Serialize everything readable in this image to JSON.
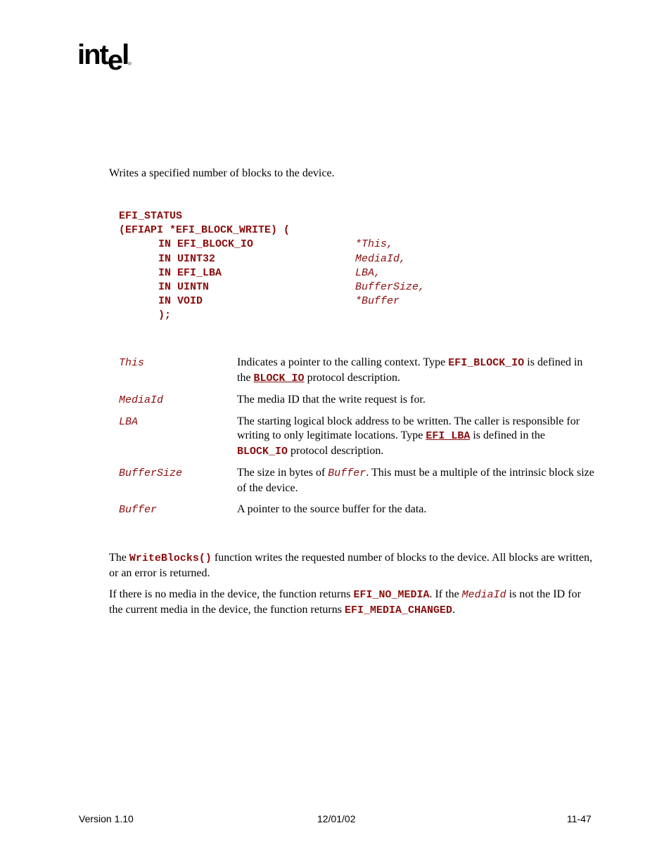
{
  "header": {
    "logo_text": "intel",
    "logo_main": "int",
    "logo_e": "e",
    "logo_l": "l",
    "logo_reg": "®"
  },
  "summary": "Writes a specified number of blocks to the device.",
  "prototype": {
    "return_type": "EFI_STATUS",
    "signature": "(EFIAPI *EFI_BLOCK_WRITE) (",
    "params": [
      {
        "type": "IN EFI_BLOCK_IO",
        "name": "*This,"
      },
      {
        "type": "IN UINT32",
        "name": "MediaId,"
      },
      {
        "type": "IN EFI_LBA",
        "name": "LBA,"
      },
      {
        "type": "IN UINTN",
        "name": "BufferSize,"
      },
      {
        "type": "IN VOID",
        "name": "*Buffer"
      }
    ],
    "close": ");"
  },
  "parameters": [
    {
      "name": "This",
      "desc_parts": [
        "Indicates a pointer to the calling context.  Type ",
        "EFI_BLOCK_IO",
        " is defined in the ",
        "BLOCK_IO",
        " protocol description."
      ]
    },
    {
      "name": "MediaId",
      "desc": "The media ID that the write request is for."
    },
    {
      "name": "LBA",
      "desc_parts": [
        "The starting logical block address to be written.  The caller is responsible for writing to only legitimate locations.  Type ",
        "EFI_LBA",
        " is defined in the ",
        "BLOCK_IO",
        " protocol description."
      ]
    },
    {
      "name": "BufferSize",
      "desc_parts": [
        "The size in bytes of ",
        "Buffer",
        ".  This must be a multiple of the intrinsic block size of the device."
      ]
    },
    {
      "name": "Buffer",
      "desc": "A pointer to the source buffer for the data."
    }
  ],
  "description": {
    "p1": [
      "The ",
      "WriteBlocks()",
      " function writes the requested number of blocks to the device.  All blocks are written, or an error is returned."
    ],
    "p2": [
      "If there is no media in the device, the function returns ",
      "EFI_NO_MEDIA",
      ".  If the ",
      "MediaId",
      " is not the ID for the current media in the device, the function returns ",
      "EFI_MEDIA_CHANGED",
      "."
    ]
  },
  "footer": {
    "version": "Version 1.10",
    "date": "12/01/02",
    "page": "11-47"
  }
}
